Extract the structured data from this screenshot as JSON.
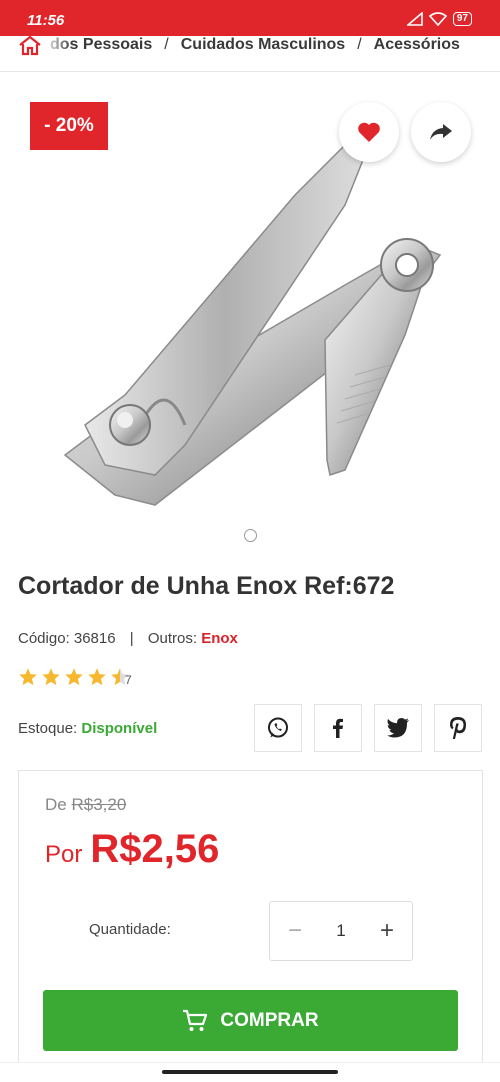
{
  "status_bar": {
    "time": "11:56",
    "battery": "97"
  },
  "breadcrumb": {
    "items": [
      "dos Pessoais",
      "Cuidados Masculinos",
      "Acessórios"
    ],
    "separator": "/"
  },
  "product": {
    "discount": "- 20%",
    "title": "Cortador de Unha Enox Ref:672",
    "code_label": "Código:",
    "code": "36816",
    "others_label": "Outros:",
    "brand": "Enox",
    "rating": 4.5,
    "review_count": "7",
    "stock_label": "Estoque:",
    "stock_status": "Disponível"
  },
  "price": {
    "old_prefix": "De",
    "old_price": "R$3,20",
    "new_prefix": "Por",
    "new_price": "R$2,56"
  },
  "quantity": {
    "label": "Quantidade:",
    "value": "1",
    "minus": "−",
    "plus": "+"
  },
  "buy_button": {
    "label": "COMPRAR"
  },
  "icons": [
    "home-icon",
    "heart-icon",
    "share-icon",
    "whatsapp-icon",
    "facebook-icon",
    "twitter-icon",
    "pinterest-icon",
    "cart-icon",
    "star-icon"
  ],
  "colors": {
    "brand_red": "#e0252b",
    "green": "#3aaa35",
    "star": "#f5b82e"
  }
}
